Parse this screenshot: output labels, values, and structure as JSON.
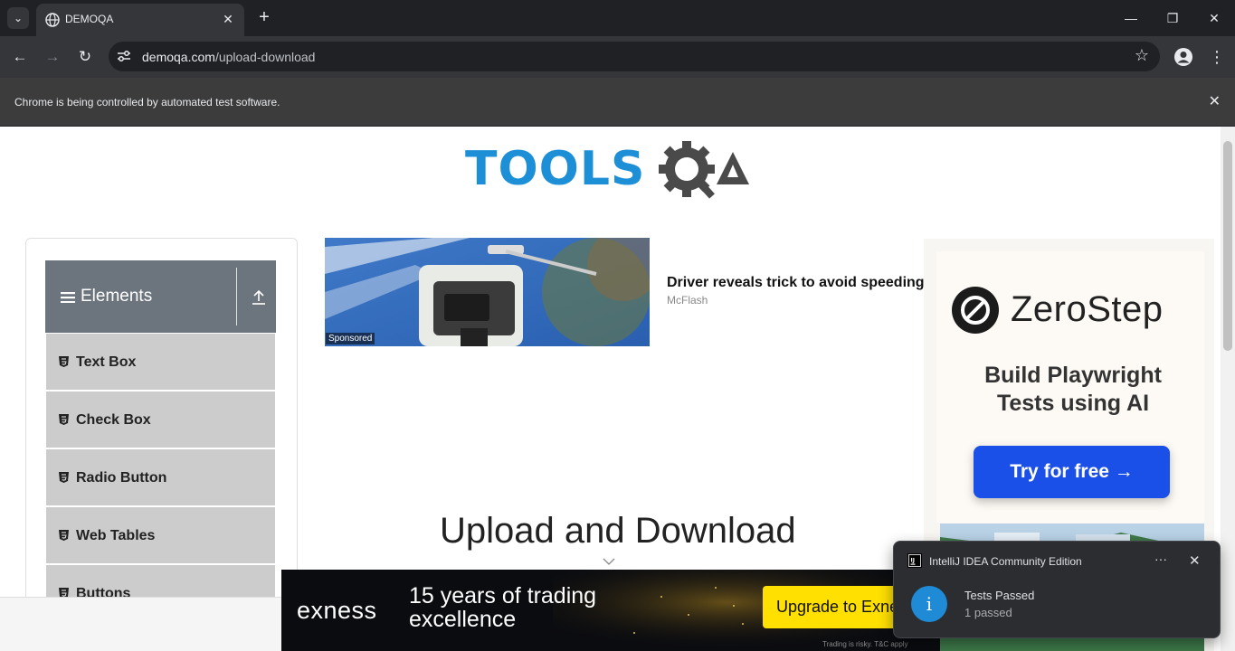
{
  "browser": {
    "tab_title": "DEMOQA",
    "url_host": "demoqa.com",
    "url_path": "/upload-download",
    "infobar_message": "Chrome is being controlled by automated test software."
  },
  "sidebar": {
    "group_label": "Elements",
    "items": [
      {
        "label": "Text Box"
      },
      {
        "label": "Check Box"
      },
      {
        "label": "Radio Button"
      },
      {
        "label": "Web Tables"
      },
      {
        "label": "Buttons"
      }
    ]
  },
  "ad": {
    "sponsored_label": "Sponsored",
    "title": "Driver reveals trick to avoid speeding",
    "source": "McFlash"
  },
  "zerostep_ad": {
    "brand": "ZeroStep",
    "headline": "Build Playwright Tests using AI",
    "cta": "Try for free →"
  },
  "main": {
    "heading": "Upload and Download"
  },
  "exness_ad": {
    "brand": "exness",
    "tagline": "15 years of trading excellence",
    "cta": "Upgrade to Exne",
    "disclaimer": "Trading is risky. T&C apply"
  },
  "notification": {
    "app": "IntelliJ IDEA Community Edition",
    "title": "Tests Passed",
    "subtitle": "1 passed"
  }
}
